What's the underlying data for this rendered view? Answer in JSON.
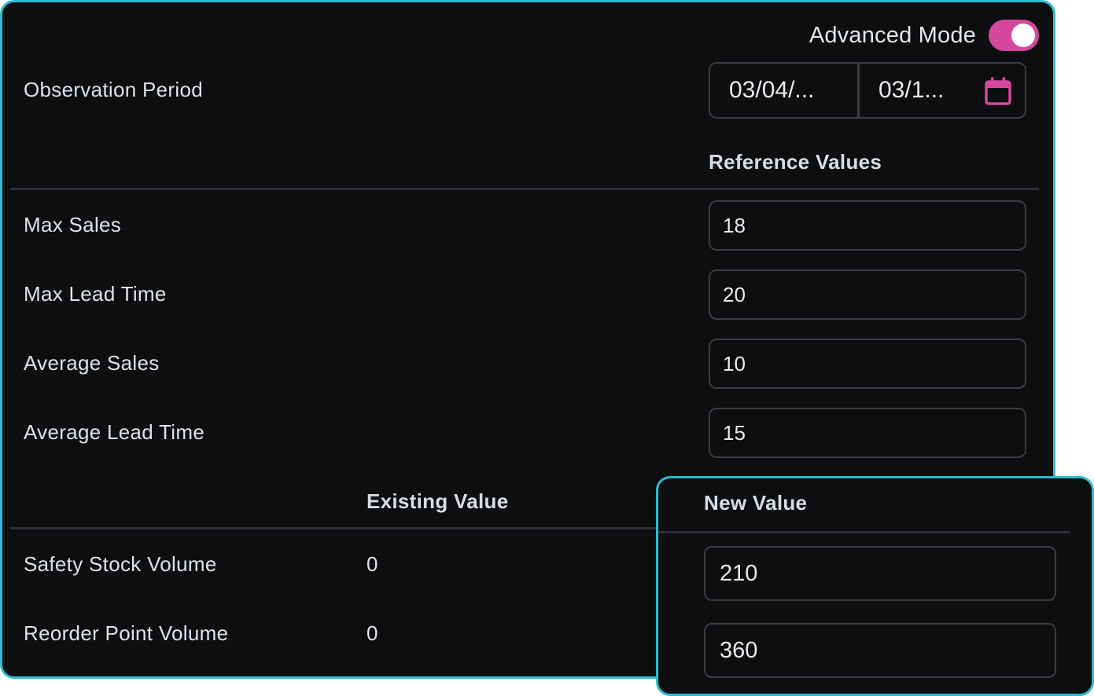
{
  "advanced_mode": {
    "label": "Advanced Mode",
    "enabled": true,
    "accent_color": "#d6489b"
  },
  "observation_period": {
    "label": "Observation Period",
    "start_date": "03/04/...",
    "end_date": "03/1...",
    "icon": "calendar-icon"
  },
  "reference_values": {
    "header": "Reference Values",
    "rows": [
      {
        "label": "Max Sales",
        "value": "18"
      },
      {
        "label": "Max Lead Time",
        "value": "20"
      },
      {
        "label": "Average Sales",
        "value": "10"
      },
      {
        "label": "Average Lead Time",
        "value": "15"
      }
    ]
  },
  "volumes": {
    "existing_header": "Existing Value",
    "new_header": "New Value",
    "rows": [
      {
        "label": "Safety Stock Volume",
        "existing": "0",
        "new": "210"
      },
      {
        "label": "Reorder Point Volume",
        "existing": "0",
        "new": "360"
      }
    ]
  },
  "colors": {
    "highlight_border": "#2bbcd1",
    "panel_background": "#0c0e10"
  }
}
